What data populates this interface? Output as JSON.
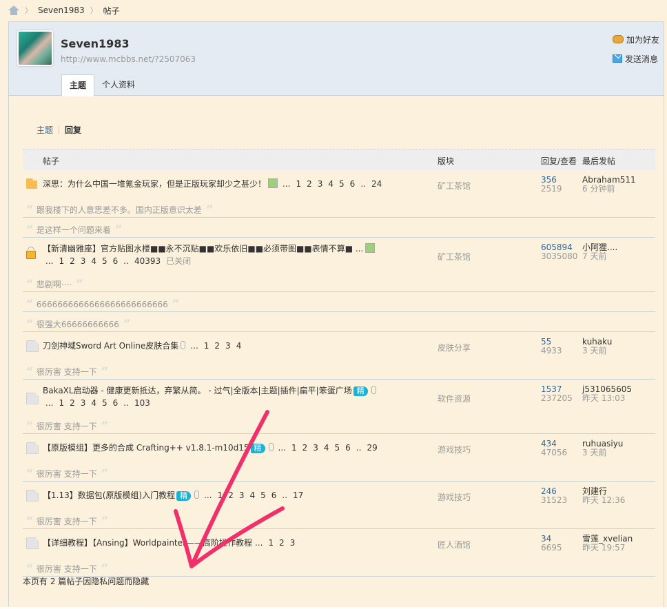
{
  "breadcrumb": {
    "home_icon": "home-icon",
    "items": [
      "Seven1983",
      "帖子"
    ]
  },
  "profile": {
    "username": "Seven1983",
    "url": "http://www.mcbbs.net/?2507063",
    "actions": [
      {
        "label": "加为好友",
        "icon": "handshake-icon"
      },
      {
        "label": "发送消息",
        "icon": "mail-icon"
      }
    ],
    "tabs": [
      {
        "label": "主题",
        "active": true
      },
      {
        "label": "个人资料",
        "active": false
      }
    ]
  },
  "subnav": {
    "items": [
      "主题",
      "回复"
    ],
    "active": "回复"
  },
  "table": {
    "headers": {
      "subject": "帖子",
      "forum": "版块",
      "counts": "回复/查看",
      "last": "最后发帖"
    },
    "threads": [
      {
        "icon": "folder",
        "title": "深思：为什么中国一堆氪金玩家，但是正版玩家却少之甚少！",
        "image": true,
        "attach": false,
        "digest": false,
        "pages": [
          "...",
          "1",
          "2",
          "3",
          "4",
          "5",
          "6",
          "..",
          "24"
        ],
        "closed": "",
        "forum": "矿工茶馆",
        "replies": "356",
        "views": "2519",
        "last_user": "Abraham511",
        "last_time": "6 分钟前",
        "quotes": [
          "跟我楼下的人意思差不多。国内正版意识太差",
          "是这样一个问题来着"
        ]
      },
      {
        "icon": "lock",
        "title": "【新清幽雅座】官方贴图水楼■■永不沉贴■■欢乐依旧■■必须带图■■表情不算■ ...",
        "image": true,
        "attach": false,
        "digest": false,
        "pages": [
          "...",
          "1",
          "2",
          "3",
          "4",
          "5",
          "6",
          "..",
          "40393"
        ],
        "closed": "已关闭",
        "forum": "矿工茶馆",
        "replies": "605894",
        "views": "3035080",
        "last_user": "小阿狸....",
        "last_time": "7 天前",
        "quotes": [
          "悲剧啊····",
          "6666666666666666666666666",
          "很强大66666666666"
        ],
        "wrap": true
      },
      {
        "icon": "file",
        "title": "刀剑神域Sword Art Online皮肤合集",
        "image": false,
        "attach": true,
        "digest": false,
        "pages": [
          "...",
          "1",
          "2",
          "3",
          "4"
        ],
        "closed": "",
        "forum": "皮肤分享",
        "replies": "55",
        "views": "4933",
        "last_user": "kuhaku",
        "last_time": "3 天前",
        "quotes": [
          "很厉害 支持一下"
        ]
      },
      {
        "icon": "file",
        "title": "BakaXL启动器 - 健康更新抵达，弃繁从简。 - 过气|全版本|主题|插件|扁平|笨蛋广场",
        "image": false,
        "attach": true,
        "digest": "精",
        "pages": [
          "...",
          "1",
          "2",
          "3",
          "4",
          "5",
          "6",
          "..",
          "103"
        ],
        "closed": "",
        "forum": "软件资源",
        "replies": "1537",
        "views": "237205",
        "last_user": "j531065605",
        "last_time": "昨天 13:03",
        "quotes": [
          "很厉害 支持一下"
        ],
        "wrap": true
      },
      {
        "icon": "file",
        "title": "【原版模组】更多的合成 Crafting++ v1.8.1-m10d15",
        "image": false,
        "attach": true,
        "digest": "精",
        "pages": [
          "...",
          "1",
          "2",
          "3",
          "4",
          "5",
          "6",
          "..",
          "29"
        ],
        "closed": "",
        "forum": "游戏技巧",
        "replies": "434",
        "views": "47056",
        "last_user": "ruhuasiyu",
        "last_time": "3 天前",
        "quotes": [
          "很厉害 支持一下"
        ]
      },
      {
        "icon": "file",
        "title": "【1.13】数据包(原版模组)入门教程",
        "image": false,
        "attach": true,
        "digest": "精",
        "pages": [
          "...",
          "1",
          "2",
          "3",
          "4",
          "5",
          "6",
          "..",
          "17"
        ],
        "closed": "",
        "forum": "游戏技巧",
        "replies": "246",
        "views": "31523",
        "last_user": "刘建行",
        "last_time": "昨天 12:36",
        "quotes": [
          "很厉害 支持一下"
        ]
      },
      {
        "icon": "file",
        "title": "【详细教程】【Ansing】Worldpainter——高阶操作教程",
        "image": false,
        "attach": false,
        "digest": false,
        "pages": [
          "...",
          "1",
          "2",
          "3"
        ],
        "closed": "",
        "forum": "匠人酒馆",
        "replies": "34",
        "views": "6695",
        "last_user": "雪莲_xvelian",
        "last_time": "昨天 19:57",
        "quotes": [
          "很厉害 支持一下"
        ]
      }
    ]
  },
  "footer_note": "本页有 2 篇帖子因隐私问题而隐藏",
  "colors": {
    "page_bg": "#fbf1dc",
    "header_bg": "#e5ebf2",
    "link": "#336699",
    "annotation_arrow": "#f0306a"
  }
}
